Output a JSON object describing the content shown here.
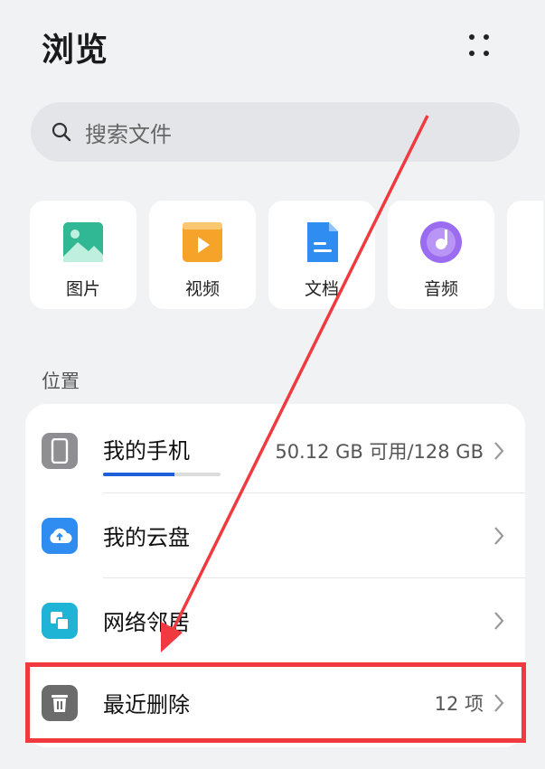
{
  "header": {
    "title": "浏览"
  },
  "search": {
    "placeholder": "搜索文件"
  },
  "categories": [
    {
      "label": "图片",
      "icon": "image-icon",
      "color": "#2fb893"
    },
    {
      "label": "视频",
      "icon": "video-icon",
      "color": "#f6a32a"
    },
    {
      "label": "文档",
      "icon": "document-icon",
      "color": "#2f8df2"
    },
    {
      "label": "音频",
      "icon": "audio-icon",
      "color": "#9b6cf0"
    }
  ],
  "locations": {
    "title": "位置",
    "items": [
      {
        "label": "我的手机",
        "value": "50.12 GB 可用/128 GB",
        "icon": "phone-icon",
        "storage_used_fraction": 0.61
      },
      {
        "label": "我的云盘",
        "value": "",
        "icon": "cloud-icon"
      },
      {
        "label": "网络邻居",
        "value": "",
        "icon": "network-icon"
      },
      {
        "label": "最近删除",
        "value": "12 项",
        "icon": "trash-icon"
      }
    ]
  },
  "colors": {
    "accent": "#1e5fd8",
    "annotation": "#f03a3f"
  }
}
